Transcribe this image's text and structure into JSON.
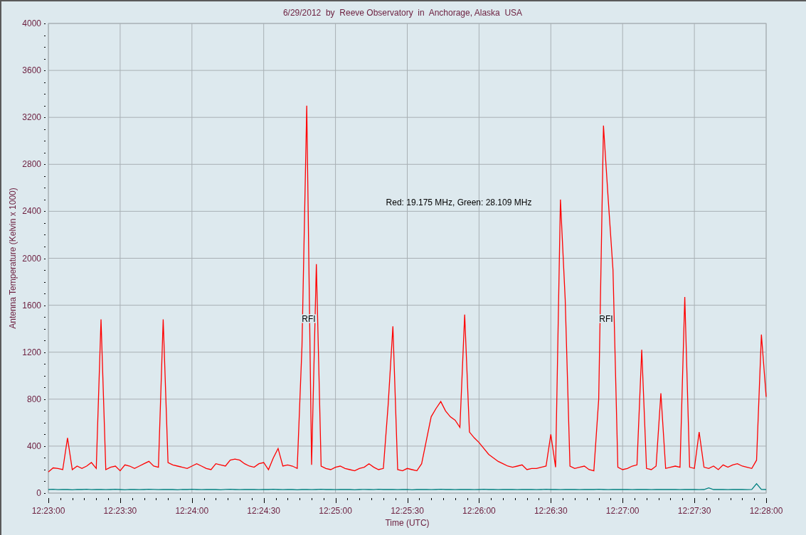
{
  "chart": {
    "title": "6/29/2012  by  Reeve Observatory  in  Anchorage, Alaska  USA",
    "chart_data": {
      "type": "line",
      "xlabel": "Time (UTC)",
      "ylabel": "Antenna Temperature (Kelvin x 1000)",
      "categories": [
        "12:23:00",
        null,
        null,
        null,
        null,
        null,
        null,
        null,
        null,
        null,
        null,
        null,
        null,
        null,
        null,
        "12:23:30",
        null,
        null,
        null,
        null,
        null,
        null,
        null,
        null,
        null,
        null,
        null,
        null,
        null,
        null,
        "12:24:00",
        null,
        null,
        null,
        null,
        null,
        null,
        null,
        null,
        null,
        null,
        null,
        null,
        null,
        null,
        "12:24:30",
        null,
        null,
        null,
        null,
        null,
        null,
        null,
        null,
        null,
        null,
        null,
        null,
        null,
        null,
        "12:25:00",
        null,
        null,
        null,
        null,
        null,
        null,
        null,
        null,
        null,
        null,
        null,
        null,
        null,
        null,
        "12:25:30",
        null,
        null,
        null,
        null,
        null,
        null,
        null,
        null,
        null,
        null,
        null,
        null,
        null,
        null,
        "12:26:00",
        null,
        null,
        null,
        null,
        null,
        null,
        null,
        null,
        null,
        null,
        null,
        null,
        null,
        null,
        "12:26:30",
        null,
        null,
        null,
        null,
        null,
        null,
        null,
        null,
        null,
        null,
        null,
        null,
        null,
        null,
        "12:27:00",
        null,
        null,
        null,
        null,
        null,
        null,
        null,
        null,
        null,
        null,
        null,
        null,
        null,
        null,
        "12:27:30",
        null,
        null,
        null,
        null,
        null,
        null,
        null,
        null,
        null,
        null,
        null,
        null,
        null,
        null,
        "12:28:00"
      ],
      "series": [
        {
          "color": "#ff0000",
          "values": [
            180,
            215,
            210,
            200,
            470,
            200,
            230,
            210,
            230,
            260,
            210,
            1480,
            200,
            220,
            230,
            190,
            240,
            230,
            210,
            230,
            250,
            270,
            230,
            220,
            1480,
            260,
            240,
            230,
            220,
            210,
            230,
            250,
            230,
            210,
            200,
            250,
            240,
            230,
            280,
            290,
            280,
            250,
            230,
            220,
            250,
            260,
            200,
            300,
            380,
            230,
            240,
            230,
            210,
            1250,
            3300,
            240,
            1950,
            230,
            210,
            200,
            220,
            230,
            210,
            200,
            190,
            210,
            220,
            250,
            220,
            200,
            210,
            750,
            1420,
            200,
            190,
            210,
            200,
            190,
            250,
            450,
            650,
            720,
            780,
            700,
            650,
            620,
            560,
            1520,
            520,
            470,
            430,
            380,
            330,
            300,
            270,
            250,
            230,
            220,
            230,
            240,
            200,
            210,
            210,
            220,
            230,
            500,
            220,
            2500,
            1650,
            230,
            210,
            220,
            230,
            200,
            190,
            800,
            3130,
            2500,
            1900,
            220,
            200,
            210,
            230,
            240,
            1220,
            210,
            200,
            230,
            850,
            210,
            220,
            230,
            220,
            1670,
            220,
            210,
            520,
            220,
            210,
            230,
            200,
            240,
            220,
            240,
            250,
            230,
            220,
            210,
            280,
            1350,
            820
          ]
        },
        {
          "color": "#008080",
          "values": [
            30,
            32,
            29,
            31,
            30,
            28,
            31,
            30,
            32,
            29,
            30,
            31,
            29,
            30,
            32,
            30,
            28,
            31,
            30,
            29,
            30,
            32,
            31,
            29,
            30,
            31,
            30,
            28,
            31,
            30,
            32,
            30,
            29,
            31,
            30,
            30,
            28,
            31,
            32,
            30,
            29,
            30,
            31,
            30,
            29,
            31,
            30,
            32,
            30,
            29,
            31,
            30,
            28,
            30,
            31,
            29,
            30,
            32,
            30,
            31,
            29,
            30,
            31,
            30,
            28,
            30,
            31,
            30,
            29,
            32,
            30,
            31,
            30,
            29,
            30,
            31,
            28,
            30,
            31,
            30,
            29,
            30,
            32,
            30,
            31,
            29,
            30,
            31,
            30,
            29,
            30,
            32,
            30,
            31,
            29,
            30,
            31,
            30,
            29,
            30,
            31,
            30,
            29,
            30,
            32,
            30,
            31,
            29,
            30,
            31,
            30,
            29,
            30,
            31,
            30,
            32,
            30,
            29,
            31,
            30,
            30,
            31,
            29,
            30,
            31,
            30,
            29,
            30,
            31,
            30,
            30,
            31,
            29,
            30,
            31,
            30,
            29,
            30,
            45,
            30,
            31,
            30,
            29,
            31,
            30,
            30,
            29,
            31,
            80,
            31,
            30
          ]
        }
      ],
      "ylim": [
        0,
        4000
      ],
      "yticks": [
        0,
        400,
        800,
        1200,
        1600,
        2000,
        2400,
        2800,
        3200,
        3600,
        4000
      ],
      "grid": true
    },
    "legend_note": "Red: 19.175 MHz, Green: 28.109 MHz",
    "markers": [
      "RFI",
      "RFI"
    ]
  }
}
